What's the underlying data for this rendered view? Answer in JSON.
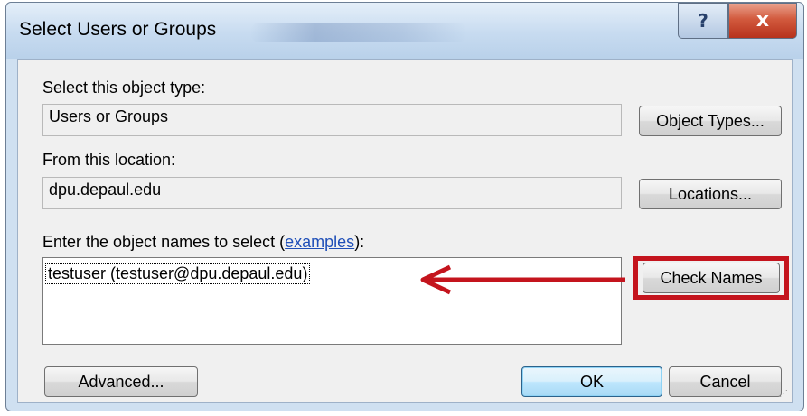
{
  "window": {
    "title": "Select Users or Groups",
    "help_glyph": "?",
    "close_glyph": "x"
  },
  "object_type": {
    "label": "Select this object type:",
    "value": "Users or Groups",
    "button": "Object Types..."
  },
  "location": {
    "label": "From this location:",
    "value": "dpu.depaul.edu",
    "button": "Locations..."
  },
  "names": {
    "label_prefix": "Enter the object names to select (",
    "label_link": "examples",
    "label_suffix": "):",
    "value": "testuser (testuser@dpu.depaul.edu)",
    "check_button": "Check Names"
  },
  "footer": {
    "advanced_button": "Advanced...",
    "ok_button": "OK",
    "cancel_button": "Cancel"
  },
  "colors": {
    "annotation_red": "#c4141d",
    "close_red": "#c5432a",
    "link_blue": "#1f4fb8"
  }
}
